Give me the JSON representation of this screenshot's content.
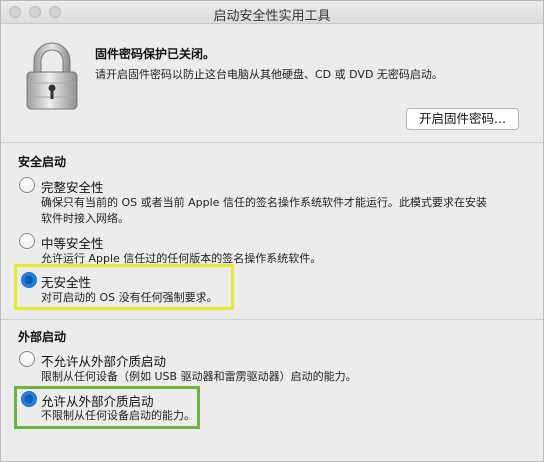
{
  "window": {
    "title": "启动安全性实用工具"
  },
  "firmware": {
    "heading": "固件密码保护已关闭。",
    "description": "请开启固件密码以防止这台电脑从其他硬盘、CD 或 DVD 无密码启动。",
    "button_label": "开启固件密码..."
  },
  "secure_boot": {
    "heading": "安全启动",
    "options": [
      {
        "label": "完整安全性",
        "desc_line1": "确保只有当前的 OS 或者当前 Apple 信任的签名操作系统软件才能运行。此模式要求在安装",
        "desc_line2": "软件时接入网络。",
        "selected": false
      },
      {
        "label": "中等安全性",
        "desc_line1": "允许运行 Apple 信任过的任何版本的签名操作系统软件。",
        "desc_line2": "",
        "selected": false
      },
      {
        "label": "无安全性",
        "desc_line1": "对可启动的 OS 没有任何强制要求。",
        "desc_line2": "",
        "selected": true
      }
    ]
  },
  "external_boot": {
    "heading": "外部启动",
    "options": [
      {
        "label": "不允许从外部介质启动",
        "desc_line1": "限制从任何设备（例如 USB 驱动器和雷雳驱动器）启动的能力。",
        "selected": false
      },
      {
        "label": "允许从外部介质启动",
        "desc_line1": "不限制从任何设备启动的能力。",
        "selected": true
      }
    ]
  },
  "highlight_colors": {
    "secure_boot_none": "#e8e82a",
    "external_allow": "#6cb33e"
  }
}
